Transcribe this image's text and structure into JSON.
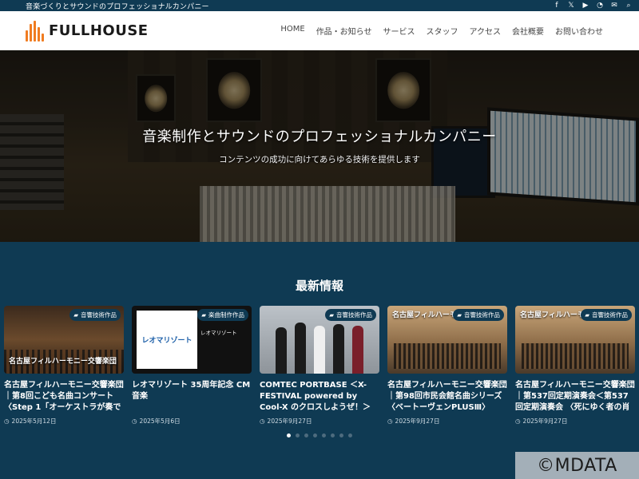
{
  "topbar": {
    "tagline": "音楽づくりとサウンドのプロフェッショナルカンパニー",
    "socials": [
      {
        "icon": "facebook-icon",
        "glyph": "f"
      },
      {
        "icon": "x-icon",
        "glyph": "𝕏"
      },
      {
        "icon": "youtube-icon",
        "glyph": "▶"
      },
      {
        "icon": "rss-icon",
        "glyph": "◔"
      },
      {
        "icon": "mail-icon",
        "glyph": "✉"
      },
      {
        "icon": "search-icon",
        "glyph": "⌕"
      }
    ]
  },
  "header": {
    "logo_text": "FULLHOUSE",
    "nav": [
      "HOME",
      "作品・お知らせ",
      "サービス",
      "スタッフ",
      "アクセス",
      "会社概要",
      "お問い合わせ"
    ]
  },
  "hero": {
    "title": "音楽制作とサウンドのプロフェッショナルカンパニー",
    "subtitle": "コンテンツの成功に向けてあらゆる技術を提供します"
  },
  "news": {
    "heading": "最新情報",
    "cards": [
      {
        "badge": "音響技術作品",
        "title": "名古屋フィルハーモニー交響楽団｜第8回こども名曲コンサート〈Step 1「オーケストラが奏で",
        "date": "2025年5月12日",
        "overlay": "名古屋フィルハーモニー交響楽団"
      },
      {
        "badge": "楽曲制作作品",
        "title": "レオマリゾート 35周年記念 CM音楽",
        "date": "2025年5月6日",
        "logo": "レオマリゾート"
      },
      {
        "badge": "音響技術作品",
        "title": "COMTEC PORTBASE ＜X-FESTIVAL powered by Cool-X のクロスしようぜ！＞",
        "date": "2025年9月27日"
      },
      {
        "badge": "音響技術作品",
        "title": "名古屋フィルハーモニー交響楽団｜第98回市民会館名曲シリーズ〈ベートーヴェンPLUSⅢ〉",
        "date": "2025年9月27日",
        "overlay": "名古屋フィルハーモニー交響楽団"
      },
      {
        "badge": "音響技術作品",
        "title": "名古屋フィルハーモニー交響楽団｜第537回定期演奏会＜第537回定期演奏会 〈死にゆく者の肖",
        "date": "2025年9月27日",
        "overlay": "名古屋フィルハーモニー交響楽団"
      }
    ],
    "pagination": {
      "count": 8,
      "active": 0
    }
  },
  "watermark": "©MDATA",
  "colors": {
    "navy": "#0f3a53",
    "accent": "#f07c21"
  }
}
